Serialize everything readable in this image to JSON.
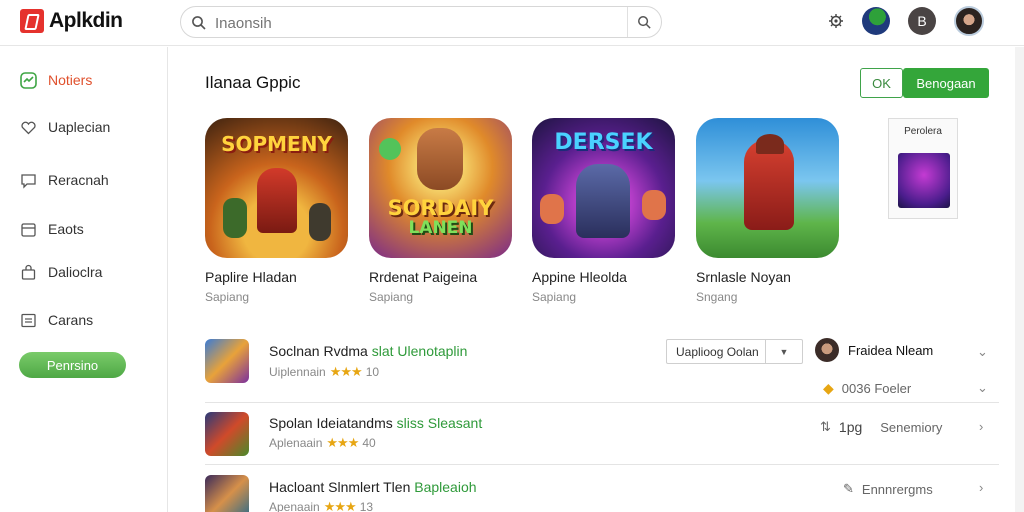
{
  "app": {
    "name": "Aplkdin"
  },
  "search": {
    "placeholder": "Inaonsih"
  },
  "header": {
    "avatar_letter": "B"
  },
  "sidebar": {
    "items": [
      {
        "label": "Notiers",
        "icon": "activity-icon",
        "active": true
      },
      {
        "label": "Uaplecian",
        "icon": "heart-icon"
      },
      {
        "label": "Reracnah",
        "icon": "chat-icon"
      },
      {
        "label": "Eaots",
        "icon": "calendar-icon"
      },
      {
        "label": "Dalioclra",
        "icon": "bag-icon"
      },
      {
        "label": "Carans",
        "icon": "list-icon"
      }
    ],
    "button_label": "Penrsino"
  },
  "main": {
    "title": "Ilanaa Gppic",
    "ok_button": "OK",
    "primary_button": "Benogaan",
    "cards": [
      {
        "name": "Paplire Hladan",
        "sub": "Sapiang",
        "art_text": "SOPMENY",
        "art_sub": ""
      },
      {
        "name": "Rrdenat Paigeina",
        "sub": "Sapiang",
        "art_text": "SORDAIY",
        "art_sub": "LANEN"
      },
      {
        "name": "Appine Hleolda",
        "sub": "Sapiang",
        "art_text": "DERSEK",
        "art_sub": ""
      },
      {
        "name": "Srnlasle Noyan",
        "sub": "Sngang",
        "art_text": "",
        "art_sub": ""
      }
    ],
    "promo": {
      "label": "Perolera"
    },
    "rows": [
      {
        "title_plain": "Soclnan Rvdma ",
        "title_highlight": "slat Ulenotaplin",
        "sub": "Uiplennain",
        "rating": "10",
        "select_value": "Uaplioog Oolan",
        "user_name": "Fraidea Nleam",
        "meta": "0036 Foeler"
      },
      {
        "title_plain": "Spolan Ideiatandms ",
        "title_highlight": "sliss Sleasant",
        "sub": "Aplenaain",
        "rating": "40",
        "meta_count": "1pg",
        "meta_label": "Senemiory"
      },
      {
        "title_plain": "Hacloant Slnmlert Tlen ",
        "title_highlight": "Bapleaioh",
        "sub": "Apenaain",
        "rating": "13",
        "meta_label": "Ennnrergms"
      }
    ]
  },
  "colors": {
    "accent": "#34a63a",
    "brand": "#e5322d",
    "active_nav": "#e0502c",
    "star": "#e7a613"
  }
}
